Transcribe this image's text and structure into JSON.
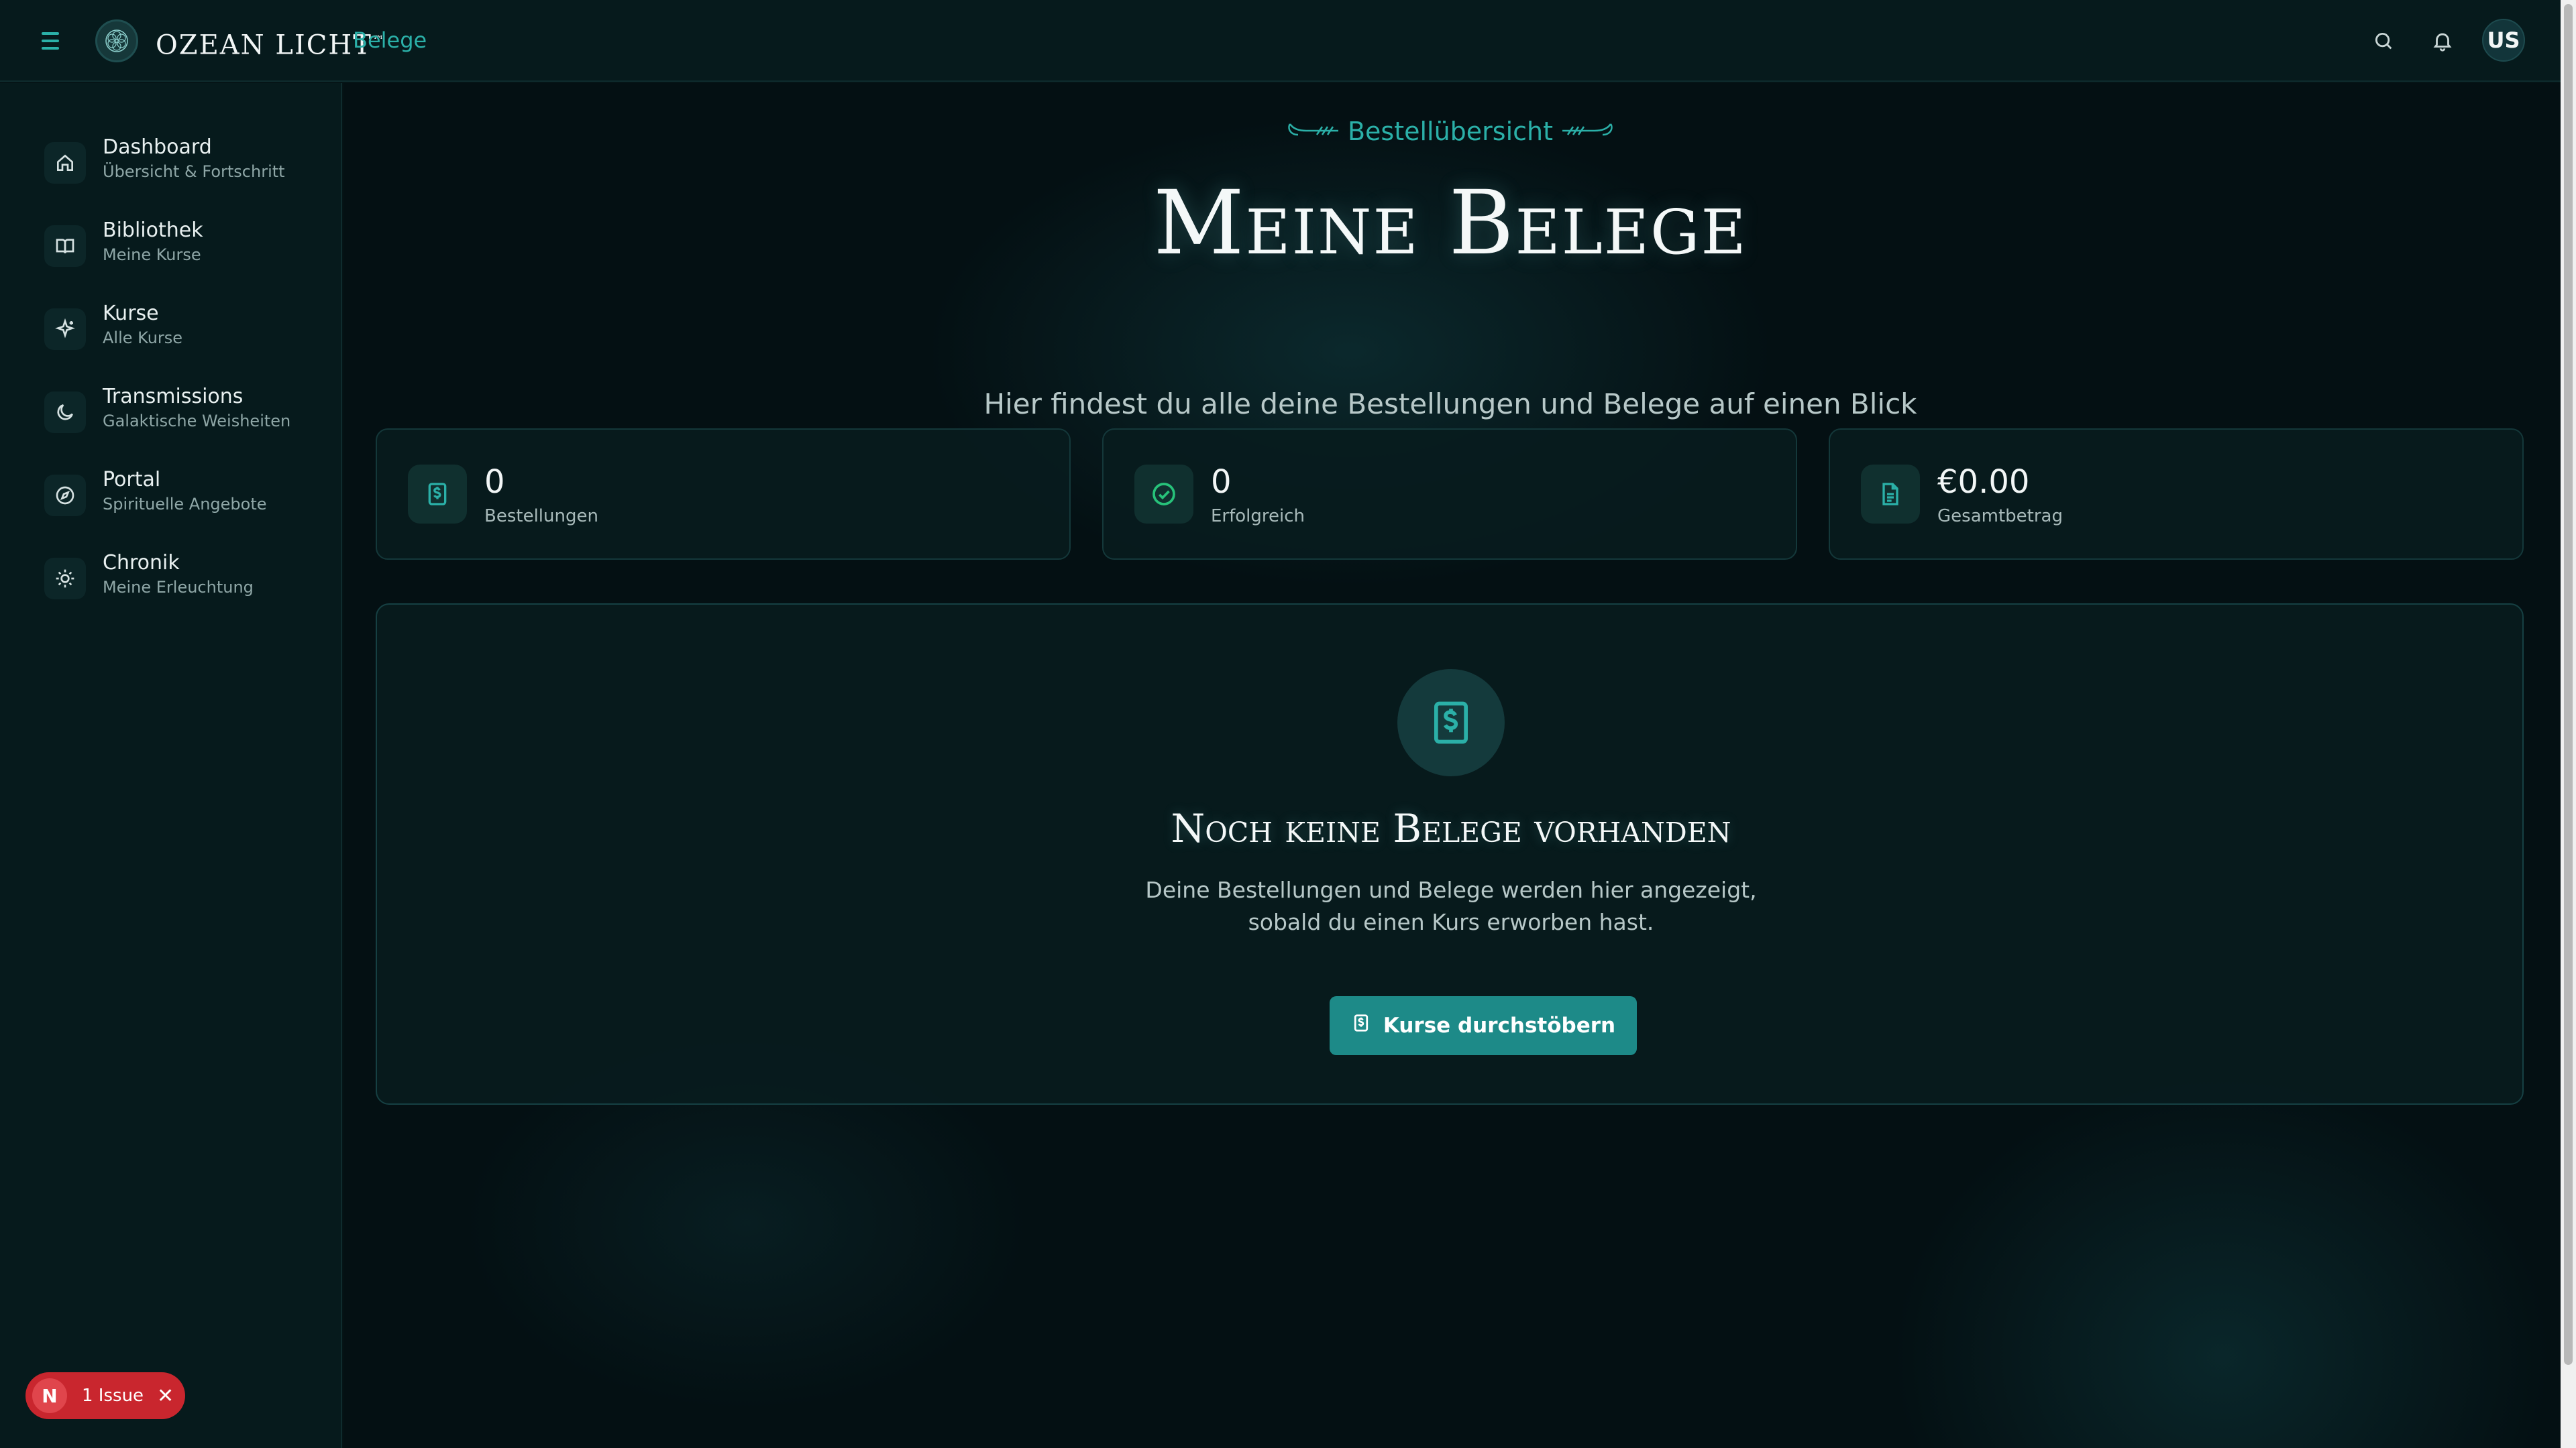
{
  "app": {
    "brand": "OZEAN LICHT",
    "trademark": "™",
    "breadcrumb": "Belege"
  },
  "header": {
    "avatar_initials": "US"
  },
  "sidebar": {
    "items": [
      {
        "label": "Dashboard",
        "sub": "Übersicht & Fortschritt",
        "icon": "home-icon"
      },
      {
        "label": "Bibliothek",
        "sub": "Meine Kurse",
        "icon": "book-icon"
      },
      {
        "label": "Kurse",
        "sub": "Alle Kurse",
        "icon": "sparkles-icon"
      },
      {
        "label": "Transmissions",
        "sub": "Galaktische Weisheiten",
        "icon": "moon-icon"
      },
      {
        "label": "Portal",
        "sub": "Spirituelle Angebote",
        "icon": "compass-icon"
      },
      {
        "label": "Chronik",
        "sub": "Meine Erleuchtung",
        "icon": "sun-icon"
      }
    ]
  },
  "main": {
    "eyebrow": "Bestellübersicht",
    "title": "Meine Belege",
    "subtitle": "Hier findest du alle deine Bestellungen und Belege auf einen Blick",
    "stats": [
      {
        "value": "0",
        "label": "Bestellungen",
        "icon": "receipt-icon"
      },
      {
        "value": "0",
        "label": "Erfolgreich",
        "icon": "check-circle-icon"
      },
      {
        "value": "€0.00",
        "label": "Gesamtbetrag",
        "icon": "document-icon"
      }
    ],
    "empty": {
      "title": "Noch keine Belege vorhanden",
      "line1": "Deine Bestellungen und Belege werden hier angezeigt,",
      "line2": "sobald du einen Kurs erworben hast.",
      "button": "Kurse durchstöbern"
    }
  },
  "issues": {
    "badge_letter": "N",
    "label": "1 Issue",
    "close": "✕"
  },
  "colors": {
    "accent": "#2bb0a8",
    "button": "#1d8a88",
    "background": "#051416",
    "issue": "#c9262e"
  }
}
